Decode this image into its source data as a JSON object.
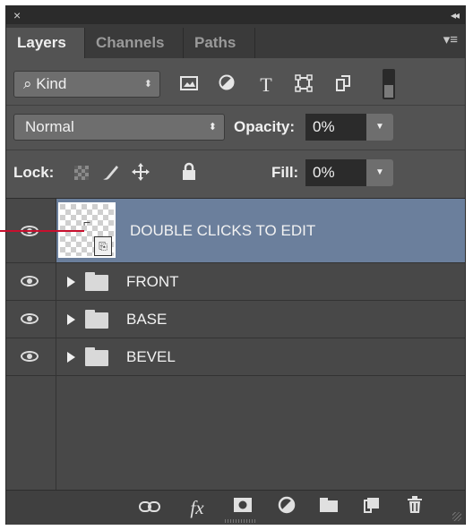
{
  "panel": {
    "close_glyph": "×",
    "collapse_glyph": "◂◂",
    "tabs": [
      "Layers",
      "Channels",
      "Paths"
    ],
    "active_tab": "Layers",
    "menu_glyph": "▾≡"
  },
  "filter": {
    "kind_icon": "⌕",
    "kind_label": "Kind",
    "select_arrow": "⬍",
    "icons": [
      "image-filter-icon",
      "adjustment-filter-icon",
      "type-filter-icon",
      "shape-filter-icon",
      "smart-object-filter-icon"
    ]
  },
  "blend": {
    "mode": "Normal",
    "opacity_label": "Opacity:",
    "opacity_value": "0%",
    "fill_label": "Fill:",
    "fill_value": "0%"
  },
  "lock": {
    "label": "Lock:"
  },
  "layers": [
    {
      "name": "DOUBLE CLICKS TO EDIT",
      "type": "smart-object",
      "visible": true,
      "selected": true
    },
    {
      "name": "FRONT",
      "type": "group",
      "visible": true,
      "selected": false
    },
    {
      "name": "BASE",
      "type": "group",
      "visible": true,
      "selected": false
    },
    {
      "name": "BEVEL",
      "type": "group",
      "visible": true,
      "selected": false
    }
  ],
  "bottom_icons": [
    "link-icon",
    "fx-icon",
    "mask-icon",
    "adjustment-layer-icon",
    "new-group-icon",
    "new-layer-icon",
    "trash-icon"
  ],
  "bottom_glyphs": {
    "link": "⊖",
    "fx": "fx",
    "adjust": "◐",
    "trash": "🗑"
  },
  "colors": {
    "panel_bg": "#535353",
    "selected_row": "#6b7f9c",
    "pointer_line": "#c8102e"
  }
}
